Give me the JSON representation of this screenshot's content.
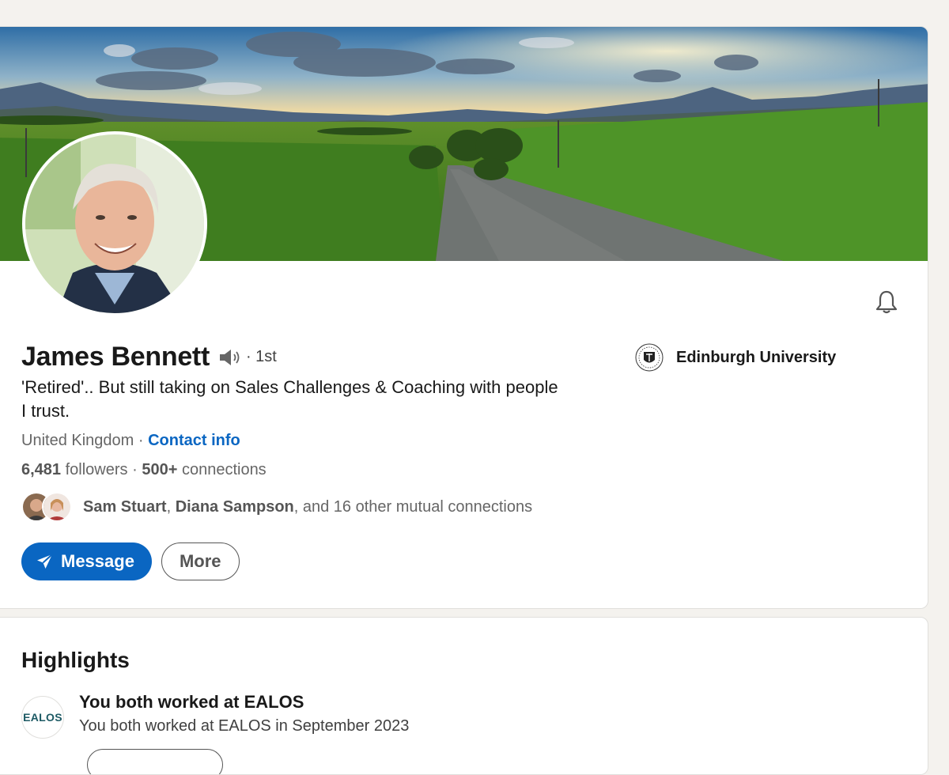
{
  "profile": {
    "name": "James Bennett",
    "degree": "· 1st",
    "headline": "'Retired'.. But still taking on Sales Challenges & Coaching with people I trust.",
    "location": "United Kingdom",
    "location_sep": " · ",
    "contact_link": "Contact info",
    "followers_count": "6,481",
    "followers_label": " followers",
    "stats_sep": " · ",
    "connections_count": "500+",
    "connections_label": " connections",
    "mutual": {
      "name1": "Sam Stuart",
      "sep": ", ",
      "name2": "Diana Sampson",
      "rest": ", and 16 other mutual connections"
    },
    "education": "Edinburgh University",
    "buttons": {
      "message": "Message",
      "more": "More"
    }
  },
  "highlights": {
    "title": "Highlights",
    "items": [
      {
        "logo_text": "EALOS",
        "heading": "You both worked at EALOS",
        "subtext": "You both worked at EALOS in September 2023"
      }
    ]
  },
  "icons": {
    "bell": "bell-icon",
    "speaker": "speaker-icon",
    "message": "paper-plane-icon",
    "education_logo": "university-crest-icon"
  },
  "colors": {
    "accent": "#0a66c2",
    "background": "#f4f2ee",
    "card": "#ffffff"
  }
}
